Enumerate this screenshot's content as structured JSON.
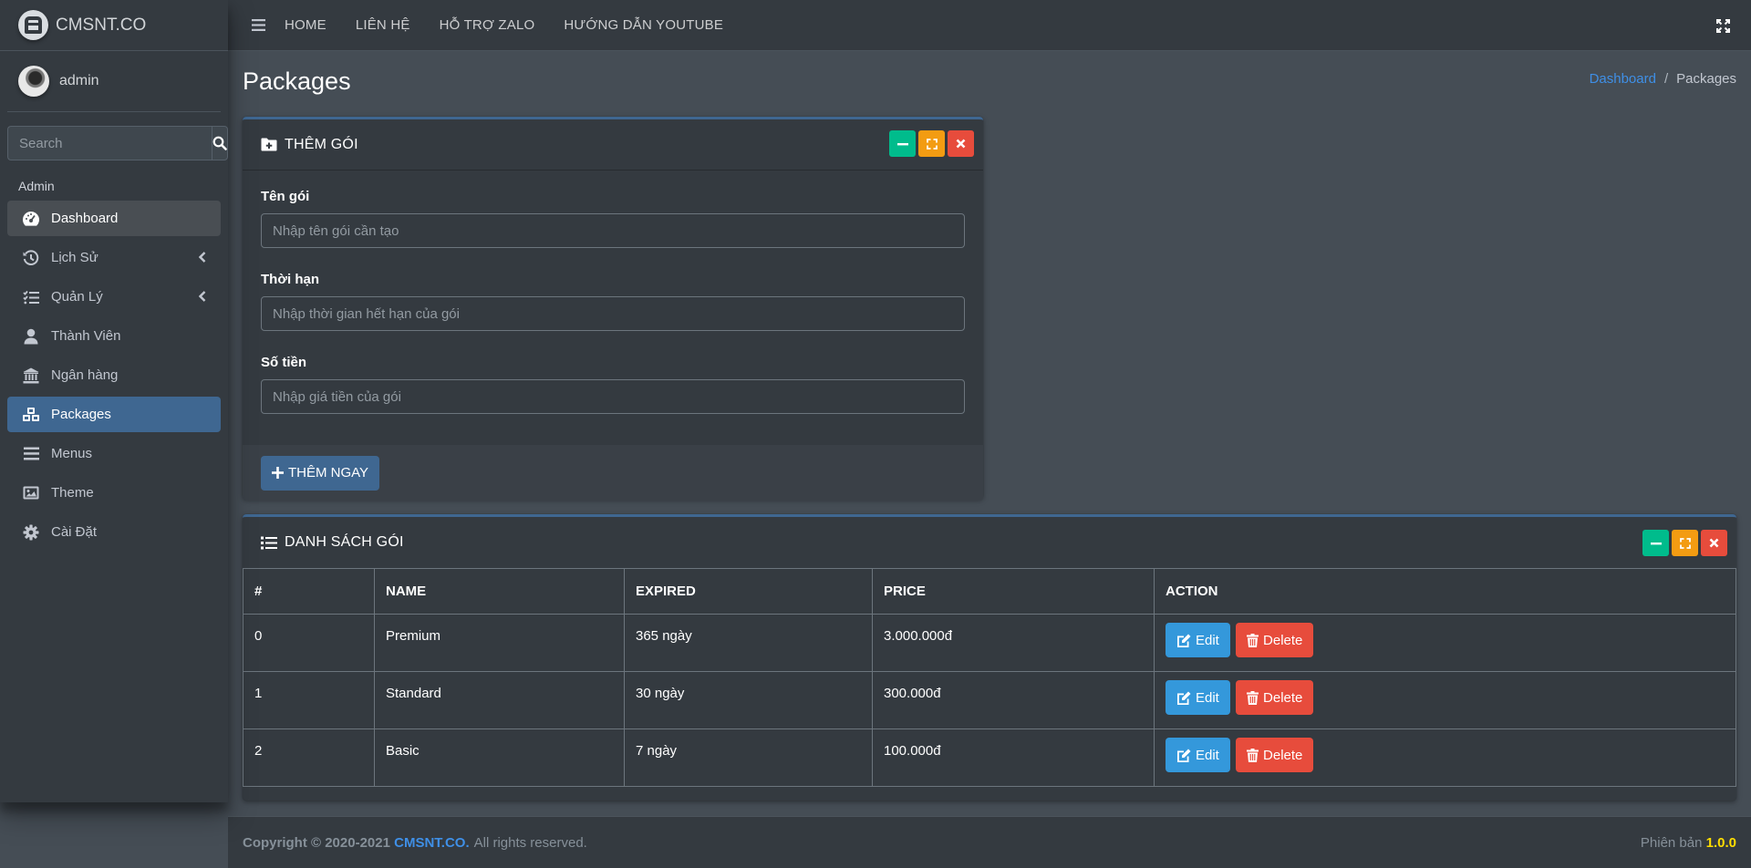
{
  "brand": {
    "name": "CMSNT.CO"
  },
  "user": {
    "name": "admin"
  },
  "sidebar": {
    "search_placeholder": "Search",
    "section_header": "Admin",
    "items": [
      {
        "label": "Dashboard",
        "icon": "dashboard-icon"
      },
      {
        "label": "Lịch Sử",
        "icon": "history-icon"
      },
      {
        "label": "Quản Lý",
        "icon": "list-check-icon"
      },
      {
        "label": "Thành Viên",
        "icon": "user-icon"
      },
      {
        "label": "Ngân hàng",
        "icon": "bank-icon"
      },
      {
        "label": "Packages",
        "icon": "cubes-icon"
      },
      {
        "label": "Menus",
        "icon": "bars-icon"
      },
      {
        "label": "Theme",
        "icon": "image-icon"
      },
      {
        "label": "Cài Đặt",
        "icon": "gear-icon"
      }
    ]
  },
  "topnav": {
    "links": [
      "HOME",
      "LIÊN HỆ",
      "HỖ TRỢ ZALO",
      "HƯỚNG DẪN YOUTUBE"
    ]
  },
  "page": {
    "title": "Packages",
    "breadcrumb": [
      "Dashboard",
      "Packages"
    ]
  },
  "add_card": {
    "title": "THÊM GÓI",
    "fields": [
      {
        "label": "Tên gói",
        "placeholder": "Nhập tên gói cần tạo"
      },
      {
        "label": "Thời hạn",
        "placeholder": "Nhập thời gian hết hạn của gói"
      },
      {
        "label": "Số tiền",
        "placeholder": "Nhập giá tiền của gói"
      }
    ],
    "submit_label": "THÊM NGAY"
  },
  "list_card": {
    "title": "DANH SÁCH GÓI",
    "columns": [
      "#",
      "NAME",
      "EXPIRED",
      "PRICE",
      "ACTION"
    ],
    "rows": [
      {
        "id": "0",
        "name": "Premium",
        "expired": "365 ngày",
        "price": "3.000.000đ"
      },
      {
        "id": "1",
        "name": "Standard",
        "expired": "30 ngày",
        "price": "300.000đ"
      },
      {
        "id": "2",
        "name": "Basic",
        "expired": "7 ngày",
        "price": "100.000đ"
      }
    ],
    "edit_label": "Edit",
    "delete_label": "Delete"
  },
  "footer": {
    "copyright": "Copyright © 2020-2021",
    "brand_link": "CMSNT.CO.",
    "rights": "All rights reserved.",
    "version_label": "Phiên bản",
    "version": "1.0.0"
  },
  "colors": {
    "accent": "#3f6791",
    "link": "#3f8fe6",
    "success": "#00bc8c",
    "warning": "#f39c12",
    "danger": "#e74c3c",
    "info": "#3498db"
  }
}
